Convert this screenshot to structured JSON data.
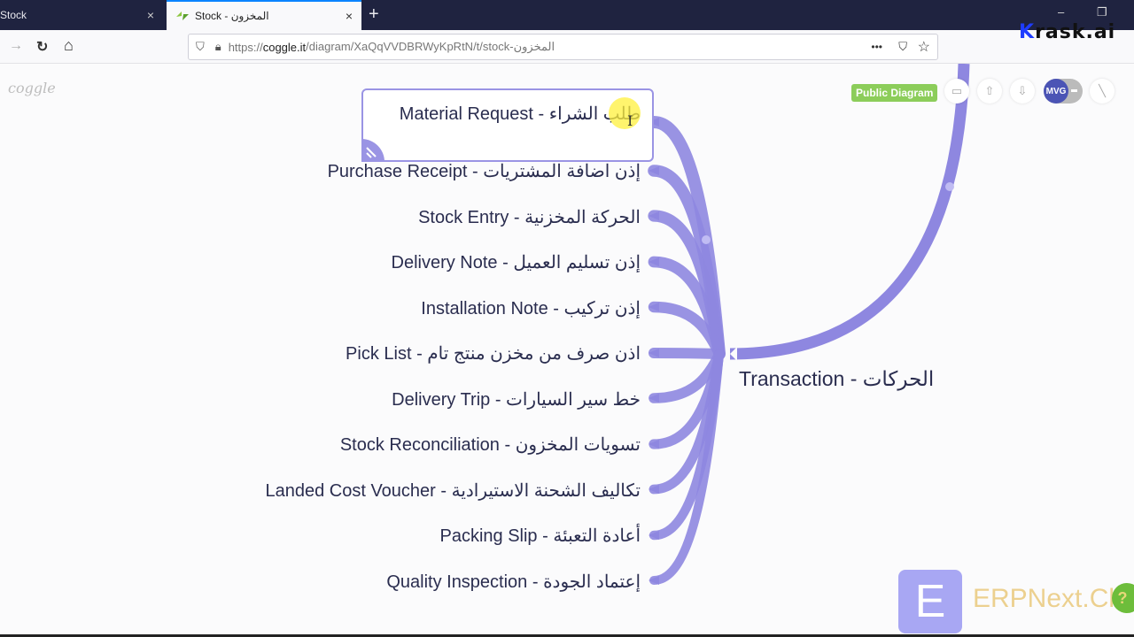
{
  "browser": {
    "tabs": [
      {
        "label": "Stock",
        "active": false
      },
      {
        "label": "Stock - المخزون",
        "active": true
      }
    ],
    "close_glyph": "×",
    "new_tab_glyph": "+",
    "window_controls": {
      "minimize": "–",
      "restore": "❐"
    },
    "url": {
      "scheme": "https://",
      "host": "coggle.it",
      "path": "/diagram/XaQqVVDBRWyKpRtN/t/stock-المخزون"
    },
    "nav": {
      "back": "←",
      "forward": "→",
      "reload": "↻",
      "home": "⌂"
    },
    "url_actions": {
      "more": "•••",
      "pocket": "⛉",
      "bookmark": "☆"
    },
    "toolbar_right": {
      "library": "|||\\",
      "sidebar": "◫",
      "account": "◉"
    }
  },
  "watermark": {
    "k": "K",
    "rest": "rask.ai"
  },
  "app": {
    "logo": "coggle",
    "public_badge": "Public Diagram",
    "toolbar_icons": {
      "present": "▭",
      "upload": "⇧",
      "download": "⇩",
      "avatar": "MVG",
      "pen": "╲"
    }
  },
  "mindmap": {
    "root": {
      "label": "Transaction - الحركات"
    },
    "branch_color": "#8e87e0",
    "children": [
      {
        "label": "Material Request - طلب الشراء",
        "selected": true
      },
      {
        "label": "Purchase Receipt - إذن اضافة المشتريات"
      },
      {
        "label": "Stock Entry - الحركة المخزنية"
      },
      {
        "label": "Delivery Note - إذن تسليم العميل"
      },
      {
        "label": "Installation Note - إذن تركيب"
      },
      {
        "label": "Pick List - اذن صرف من مخزن منتج تام"
      },
      {
        "label": "Delivery Trip - خط سير السيارات"
      },
      {
        "label": "Stock Reconciliation - تسويات المخزون"
      },
      {
        "label": "Landed Cost Voucher - تكاليف الشحنة الاستيرادية"
      },
      {
        "label": "Packing Slip - أعادة التعبئة"
      },
      {
        "label": "Quality Inspection - إعتماد الجودة"
      }
    ]
  },
  "overlay": {
    "erp_logo_letter": "E",
    "erp_text": "ERPNext.Cloud",
    "help": "?"
  }
}
